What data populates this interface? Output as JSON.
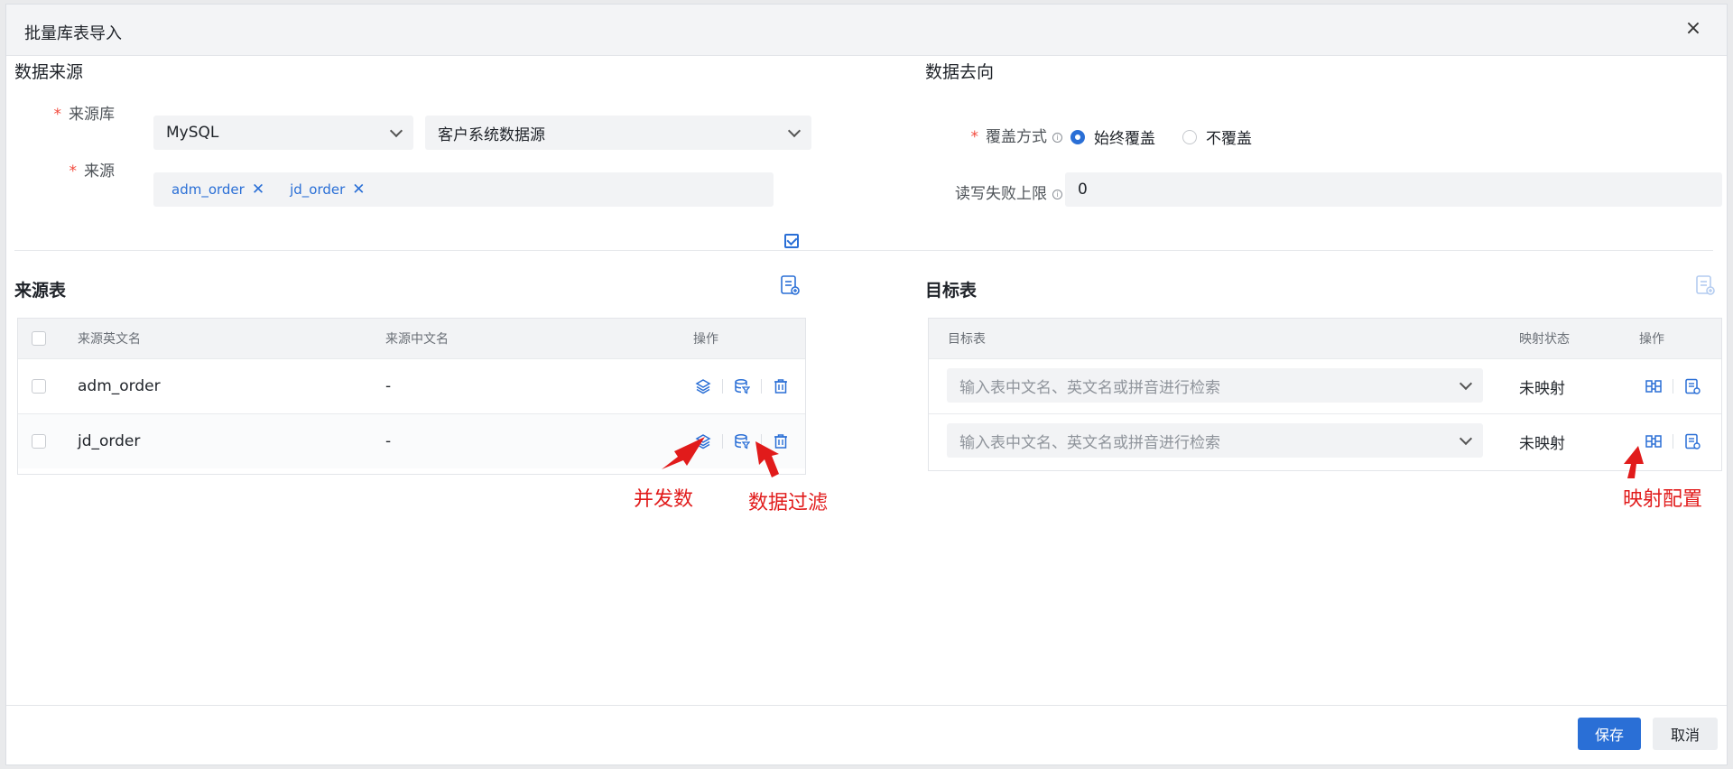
{
  "dialog": {
    "title": "批量库表导入",
    "close_icon": "×"
  },
  "source_section": {
    "title": "数据来源",
    "db_label": "来源库",
    "db_type": "MySQL",
    "db_name": "客户系统数据源",
    "source_label": "来源",
    "tags": [
      "adm_order",
      "jd_order"
    ]
  },
  "target_section": {
    "title": "数据去向",
    "mode_label": "覆盖方式",
    "mode_options": [
      "始终覆盖",
      "不覆盖"
    ],
    "mode_selected": "始终覆盖",
    "limit_label": "读写失败上限",
    "limit_value": "0"
  },
  "source_table": {
    "title": "来源表",
    "headers": [
      "来源英文名",
      "来源中文名",
      "操作"
    ],
    "rows": [
      {
        "en": "adm_order",
        "cn": "-"
      },
      {
        "en": "jd_order",
        "cn": "-"
      }
    ]
  },
  "target_table": {
    "title": "目标表",
    "headers": [
      "目标表",
      "映射状态",
      "操作"
    ],
    "placeholder": "输入表中文名、英文名或拼音进行检索",
    "rows": [
      {
        "status": "未映射"
      },
      {
        "status": "未映射"
      }
    ]
  },
  "annotations": {
    "concurrency": "并发数",
    "filter": "数据过滤",
    "mapping": "映射配置"
  },
  "footer": {
    "save": "保存",
    "cancel": "取消"
  },
  "colors": {
    "primary": "#2a6fd6",
    "required": "#f24a3d",
    "annotation": "#e11b1b"
  }
}
